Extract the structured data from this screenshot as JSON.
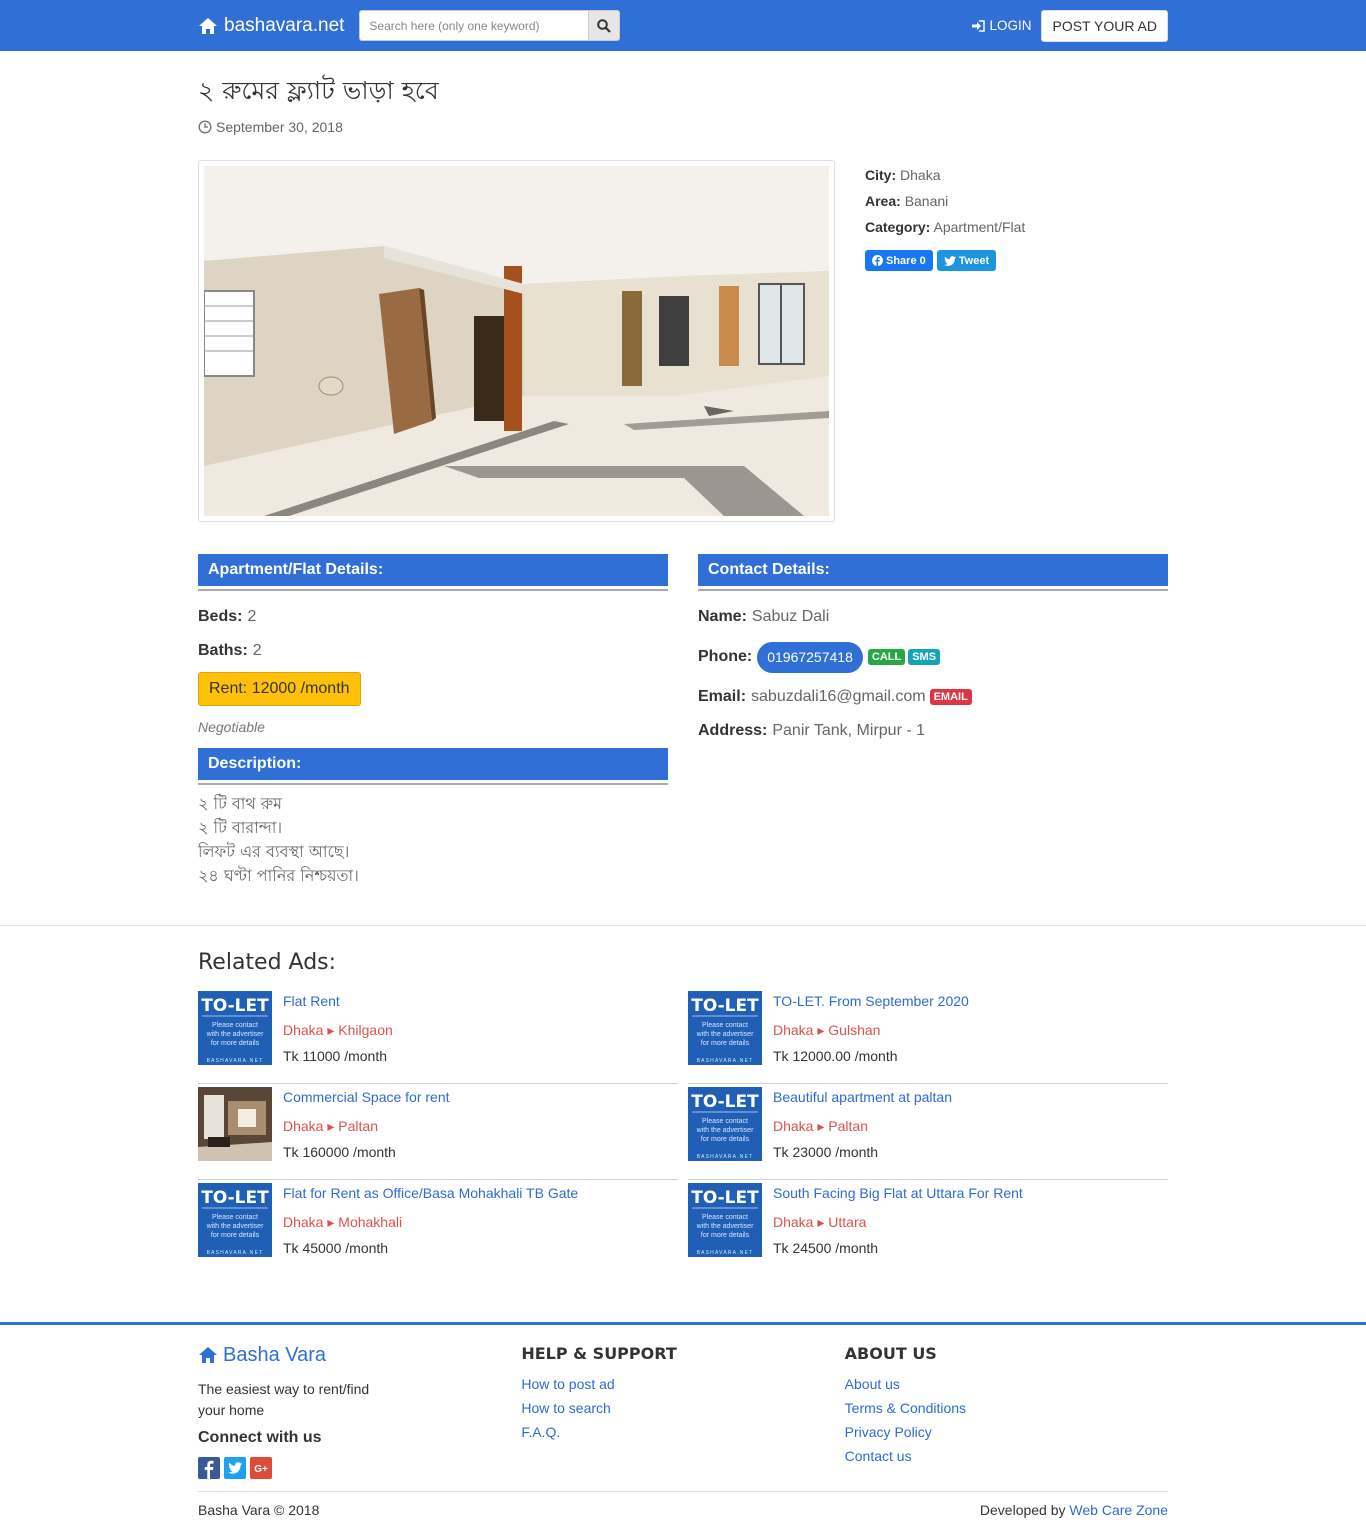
{
  "nav": {
    "brand": "bashavara.net",
    "search_placeholder": "Search here (only one keyword)",
    "login": "LOGIN",
    "post_ad": "POST YOUR AD"
  },
  "ad": {
    "title": "২ রুমের ফ্ল্যাট ভাড়া হবে",
    "date": "September 30, 2018",
    "city_label": "City:",
    "city": "Dhaka",
    "area_label": "Area:",
    "area": "Banani",
    "category_label": "Category:",
    "category": "Apartment/Flat",
    "share_label": "Share 0",
    "tweet_label": "Tweet"
  },
  "flat": {
    "heading": "Apartment/Flat Details:",
    "beds_label": "Beds:",
    "beds": "2",
    "baths_label": "Baths:",
    "baths": "2",
    "rent": "Rent: 12000 /month",
    "negotiable": "Negotiable"
  },
  "description": {
    "heading": "Description:",
    "lines": [
      "২ টি বাথ রুম",
      "২ টি বারান্দা।",
      "লিফট এর ব্যবস্থা আছে।",
      "২৪ ঘণ্টা পানির নিশ্চয়তা।"
    ]
  },
  "contact": {
    "heading": "Contact Details:",
    "name_label": "Name:",
    "name": "Sabuz Dali",
    "phone_label": "Phone:",
    "phone": "01967257418",
    "call": "CALL",
    "sms": "SMS",
    "email_label": "Email:",
    "email": "sabuzdali16@gmail.com",
    "email_btn": "EMAIL",
    "address_label": "Address:",
    "address": "Panir Tank, Mirpur - 1"
  },
  "related": {
    "title": "Related Ads:",
    "left": [
      {
        "title": "Flat Rent",
        "city": "Dhaka",
        "area": "Khilgaon",
        "price": "Tk 11000 /month"
      },
      {
        "title": "Commercial Space for rent",
        "city": "Dhaka",
        "area": "Paltan",
        "price": "Tk 160000 /month"
      },
      {
        "title": "Flat for Rent as Office/Basa Mohakhali TB Gate",
        "city": "Dhaka",
        "area": "Mohakhali",
        "price": "Tk 45000 /month"
      }
    ],
    "right": [
      {
        "title": "TO-LET. From September 2020",
        "city": "Dhaka",
        "area": "Gulshan",
        "price": "Tk 12000.00 /month"
      },
      {
        "title": "Beautiful apartment at paltan",
        "city": "Dhaka",
        "area": "Paltan",
        "price": "Tk 23000 /month"
      },
      {
        "title": "South Facing Big Flat at Uttara For Rent",
        "city": "Dhaka",
        "area": "Uttara",
        "price": "Tk 24500 /month"
      }
    ],
    "thumb_text": "TO-LET",
    "thumb_sub1": "Please contact",
    "thumb_sub2": "with the advertiser",
    "thumb_sub3": "for more details",
    "thumb_footer": "BASHAVARA.NET"
  },
  "footer": {
    "brand": "Basha Vara",
    "tagline": "The easiest way to rent/find your home",
    "connect": "Connect with us",
    "help_heading": "HELP & SUPPORT",
    "help_links": [
      "How to post ad",
      "How to search",
      "F.A.Q."
    ],
    "about_heading": "ABOUT US",
    "about_links": [
      "About us",
      "Terms & Conditions",
      "Privacy Policy",
      "Contact us"
    ],
    "copyright": "Basha Vara © 2018",
    "developed_by": "Developed by",
    "developer": "Web Care Zone"
  },
  "colors": {
    "primary": "#2f6fd6",
    "rent": "#ffc107",
    "location": "#d9534f"
  }
}
